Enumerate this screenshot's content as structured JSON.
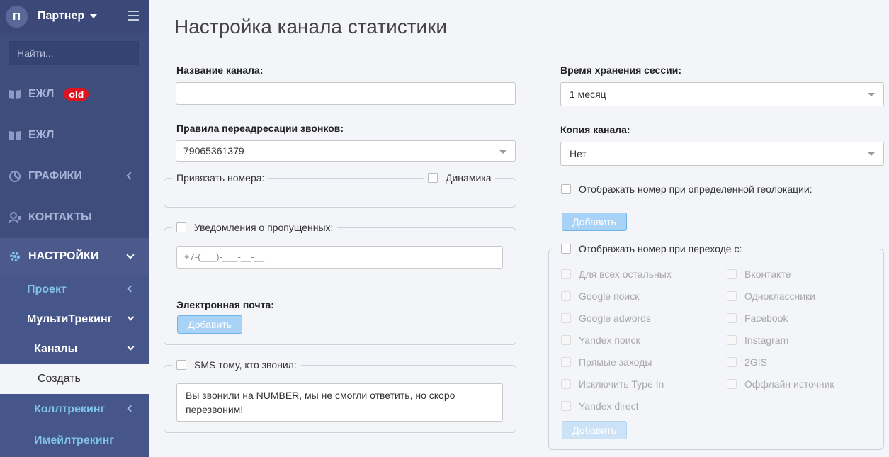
{
  "sidebar": {
    "avatar_letter": "П",
    "account_name": "Партнер",
    "search_placeholder": "Найти...",
    "items": [
      {
        "label": "ЕЖЛ",
        "badge": "old",
        "icon": "book-icon"
      },
      {
        "label": "ЕЖЛ",
        "icon": "book-icon"
      },
      {
        "label": "ГРАФИКИ",
        "icon": "pie-chart-icon"
      },
      {
        "label": "КОНТАКТЫ",
        "icon": "contacts-icon"
      },
      {
        "label": "НАСТРОЙКИ",
        "icon": "gear-icon"
      }
    ],
    "sub": {
      "project": "Проект",
      "multitracking": "МультиТрекинг",
      "channels": "Каналы",
      "create": "Создать",
      "calltracking": "Коллтрекинг",
      "emailtracking": "Имейлтрекинг"
    }
  },
  "main": {
    "title": "Настройка канала статистики",
    "channel_name_label": "Название канала:",
    "channel_name_value": "",
    "redirect_label": "Правила переадресации звонков:",
    "redirect_value": "79065361379",
    "bind_numbers_label": "Привязать номера:",
    "dynamics_label": "Динамика",
    "missed_label": "Уведомления о пропущенных:",
    "phone_placeholder": "+7-(___)-___-__-__",
    "email_label": "Электронная почта:",
    "add_label": "Добавить",
    "sms_label": "SMS тому, кто звонил:",
    "sms_text": "Вы звонили на NUMBER, мы не смогли ответить, но скоро перезвоним!",
    "session_label": "Время хранения сессии:",
    "session_value": "1 месяц",
    "copy_label": "Копия канала:",
    "copy_value": "Нет",
    "geo_label": "Отображать номер при определенной геолокации:",
    "source_label": "Отображать номер при переходе с:",
    "sources_left": [
      "Для всех остальных",
      "Google поиск",
      "Google adwords",
      "Yandex поиск",
      "Прямые заходы",
      "Исключить Type In",
      "Yandex direct"
    ],
    "sources_right": [
      "Вконтакте",
      "Одноклассники",
      "Facebook",
      "Instagram",
      "2GIS",
      "Оффлайн источник"
    ]
  }
}
